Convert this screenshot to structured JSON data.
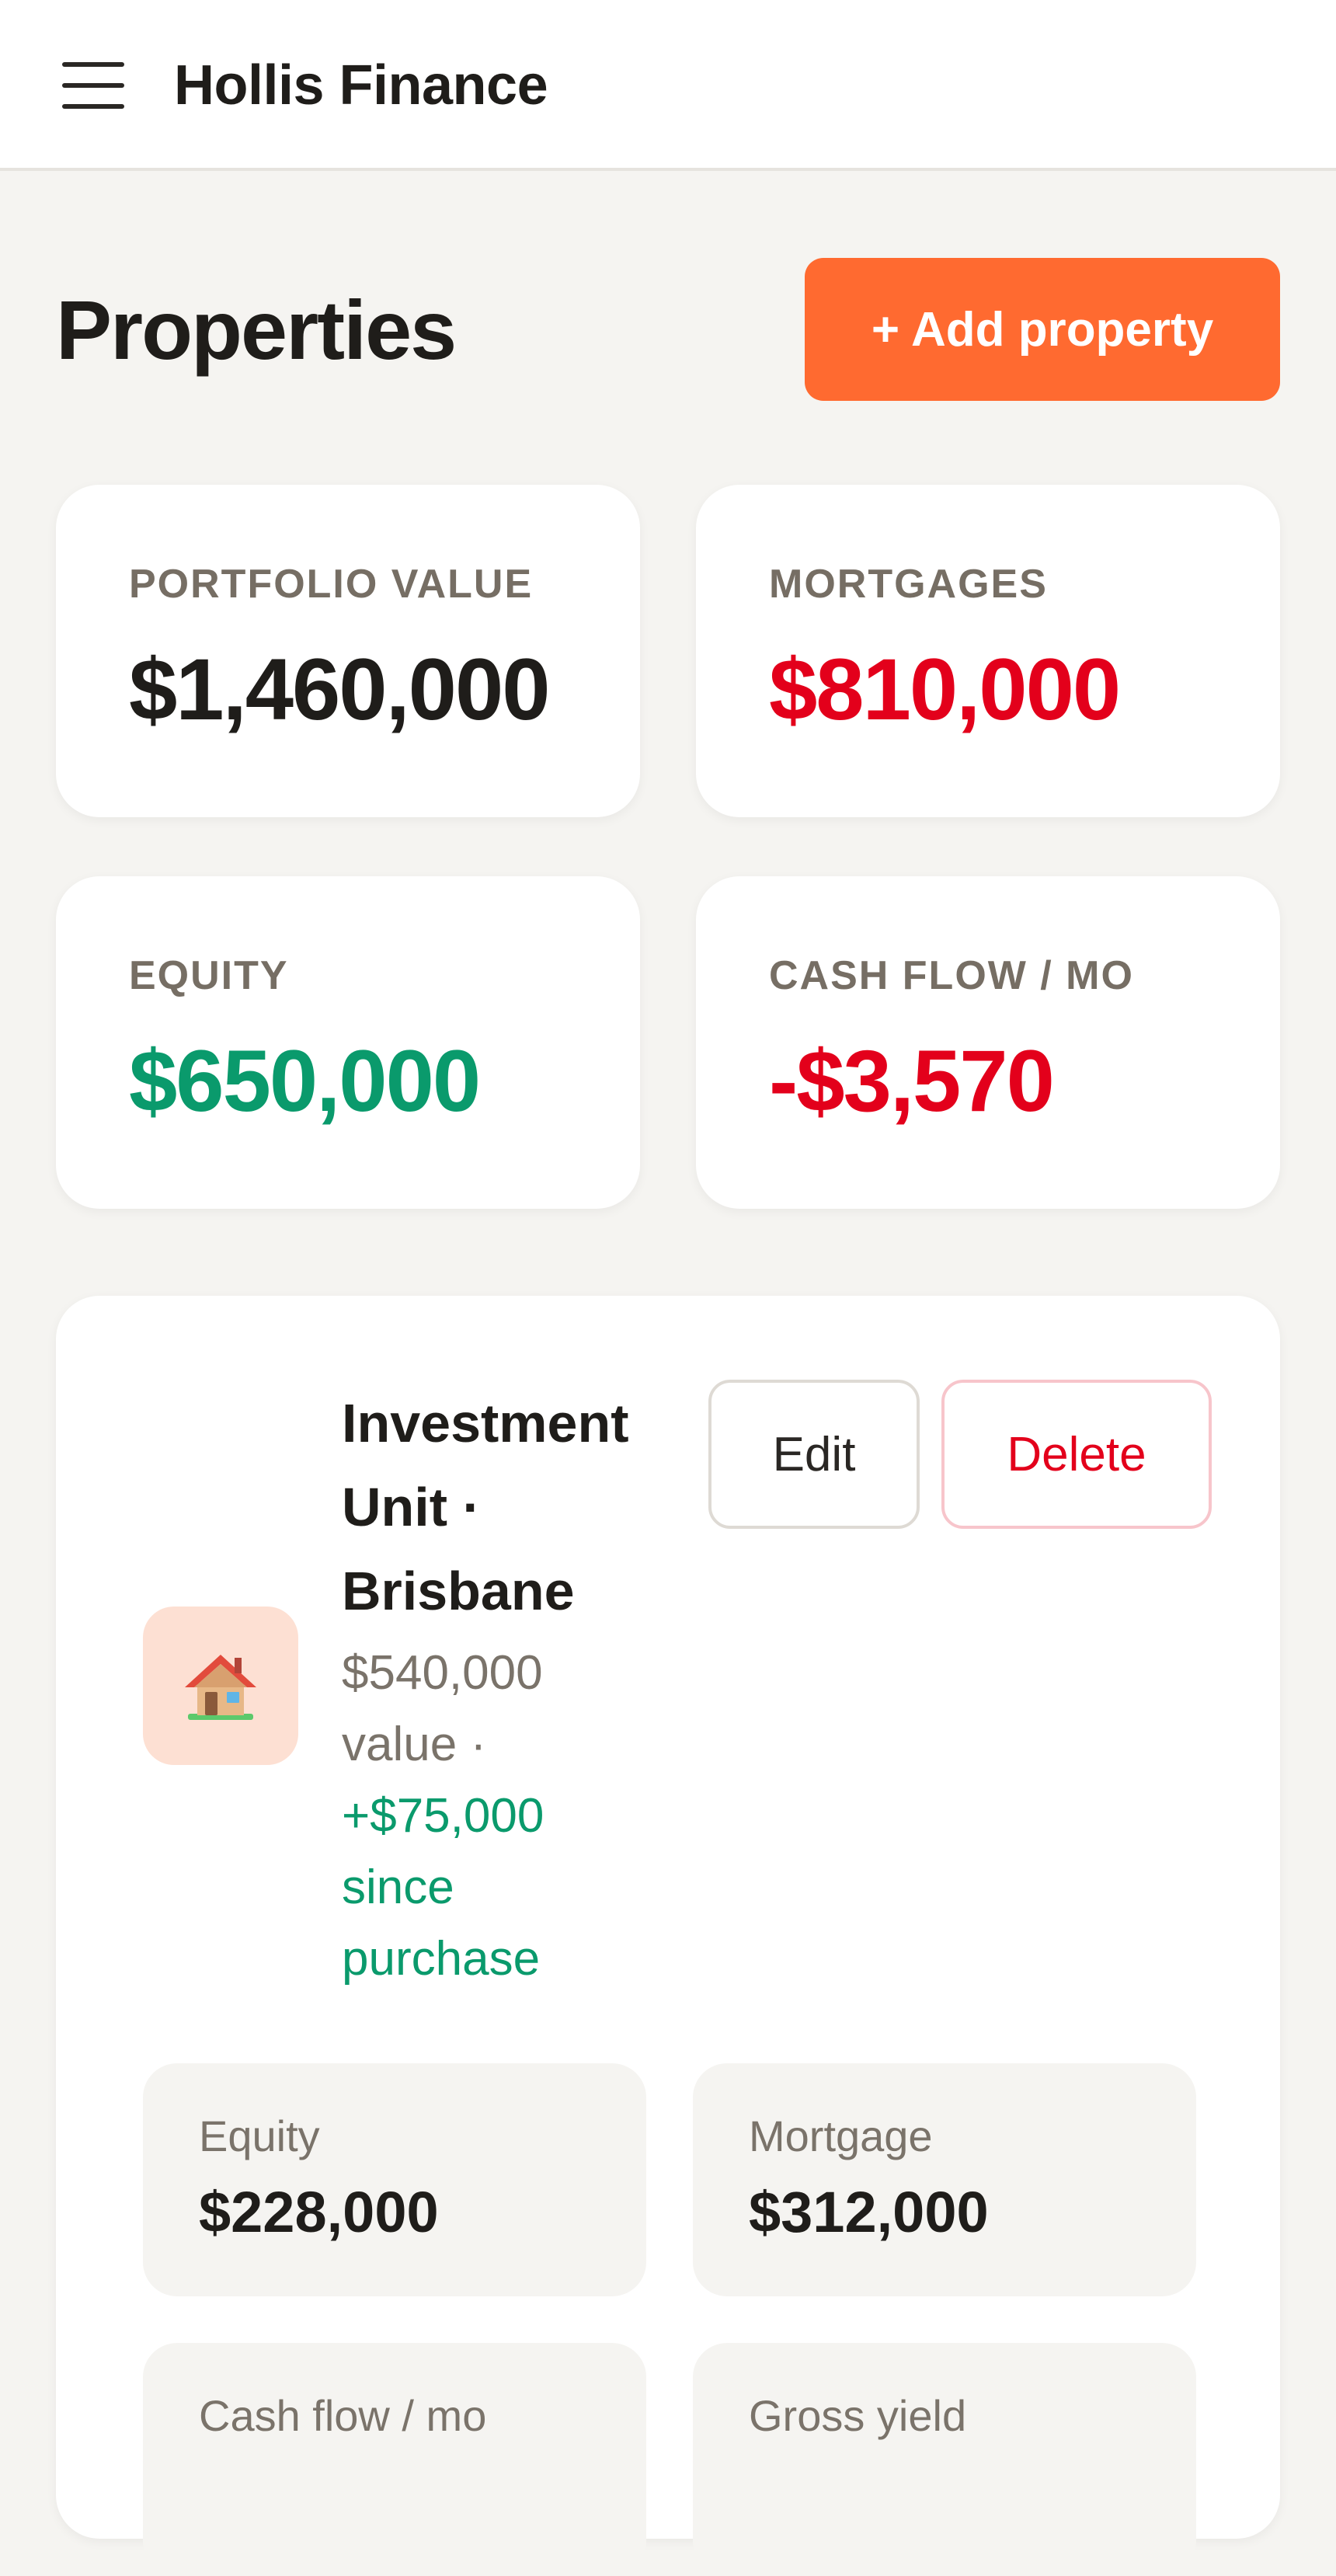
{
  "header": {
    "menu_icon": "hamburger-menu-icon",
    "app_title": "Hollis Finance"
  },
  "page": {
    "title": "Properties",
    "add_button_label": "+ Add property",
    "accent_color": "#ff6a30"
  },
  "summary": [
    {
      "label": "PORTFOLIO VALUE",
      "value": "$1,460,000",
      "tone": "neutral"
    },
    {
      "label": "MORTGAGES",
      "value": "$810,000",
      "tone": "negative"
    },
    {
      "label": "EQUITY",
      "value": "$650,000",
      "tone": "positive"
    },
    {
      "label": "CASH FLOW / MO",
      "value": "-$3,570",
      "tone": "negative"
    }
  ],
  "colors": {
    "negative": "#e3001b",
    "positive": "#0a9a6c",
    "neutral": "#1f1d1a"
  },
  "property": {
    "icon": "house-icon",
    "name": "Investment Unit · Brisbane",
    "value_text": "$540,000 value ·",
    "gain_text": "+$75,000 since purchase",
    "edit_label": "Edit",
    "delete_label": "Delete",
    "metrics": [
      {
        "label": "Equity",
        "value": "$228,000"
      },
      {
        "label": "Mortgage",
        "value": "$312,000"
      },
      {
        "label": "Cash flow / mo",
        "value": ""
      },
      {
        "label": "Gross yield",
        "value": ""
      }
    ]
  }
}
